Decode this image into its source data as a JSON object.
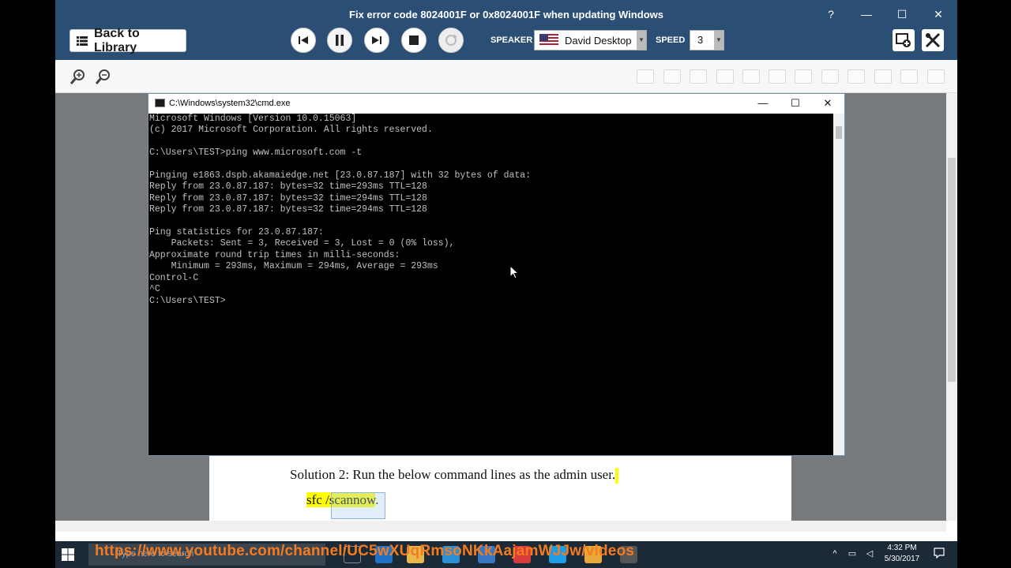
{
  "app": {
    "title": "Fix error code 8024001F or 0x8024001F when updating Windows",
    "back_label": "Back to Library",
    "speaker_label": "SPEAKER",
    "speaker_value": "David Desktop",
    "speed_label": "SPEED",
    "speed_value": "3",
    "help_glyph": "?",
    "minimize_glyph": "—",
    "maximize_glyph": "☐",
    "close_glyph": "✕"
  },
  "cmd": {
    "title": "C:\\Windows\\system32\\cmd.exe",
    "lines": [
      "Microsoft Windows [Version 10.0.15063]",
      "(c) 2017 Microsoft Corporation. All rights reserved.",
      "",
      "C:\\Users\\TEST>ping www.microsoft.com -t",
      "",
      "Pinging e1863.dspb.akamaiedge.net [23.0.87.187] with 32 bytes of data:",
      "Reply from 23.0.87.187: bytes=32 time=293ms TTL=128",
      "Reply from 23.0.87.187: bytes=32 time=294ms TTL=128",
      "Reply from 23.0.87.187: bytes=32 time=294ms TTL=128",
      "",
      "Ping statistics for 23.0.87.187:",
      "    Packets: Sent = 3, Received = 3, Lost = 0 (0% loss),",
      "Approximate round trip times in milli-seconds:",
      "    Minimum = 293ms, Maximum = 294ms, Average = 293ms",
      "Control-C",
      "^C",
      "C:\\Users\\TEST>"
    ]
  },
  "document": {
    "solution_text": "Solution 2: Run the below command lines as the admin user",
    "solution_punct": ".",
    "command_text": "sfc /scannow",
    "command_punct": "."
  },
  "taskbar": {
    "search_placeholder": "Type here to search",
    "url_overlay": "https://www.youtube.com/channel/UC5wXUqRmsoNKkAajamWJJw/videos",
    "time": "4:32 PM",
    "date": "5/30/2017"
  },
  "colors": {
    "titlebar": "#2b4e75",
    "highlight": "#ffff00",
    "overlay_text": "#f47b20"
  }
}
